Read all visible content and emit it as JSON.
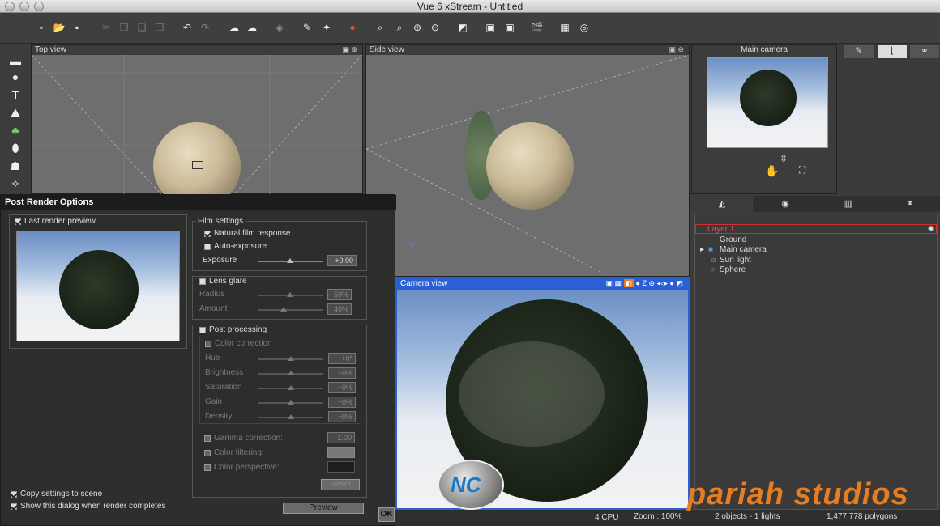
{
  "window": {
    "title": "Vue 6 xStream - Untitled"
  },
  "viewports": {
    "top": {
      "title": "Top view"
    },
    "side": {
      "title": "Side view",
      "axis_label": "Y"
    },
    "camera": {
      "title": "Camera view",
      "z_label": "Z"
    },
    "main_camera": {
      "title": "Main camera"
    }
  },
  "dialog": {
    "title": "Post Render Options",
    "last_render_preview": "Last render preview",
    "film_settings": {
      "title": "Film settings",
      "natural_film": "Natural film response",
      "auto_exposure": "Auto-exposure",
      "exposure_label": "Exposure",
      "exposure_value": "+0.00"
    },
    "lens_glare": {
      "title": "Lens glare",
      "radius_label": "Radius",
      "radius_value": "50%",
      "amount_label": "Amount",
      "amount_value": "40%"
    },
    "post_processing": {
      "title": "Post processing",
      "color_correction": "Color correction",
      "hue_label": "Hue",
      "hue_value": "+0°",
      "brightness_label": "Brightness",
      "brightness_value": "+0%",
      "saturation_label": "Saturation",
      "saturation_value": "+0%",
      "gain_label": "Gain",
      "gain_value": "+0%",
      "density_label": "Density",
      "density_value": "+0%",
      "gamma_label": "Gamma correction:",
      "gamma_value": "1.00",
      "color_filtering": "Color filtering:",
      "color_perspective": "Color perspective:",
      "reset": "Reset"
    },
    "copy_settings": "Copy settings to scene",
    "show_dialog": "Show this dialog when render completes",
    "preview": "Preview",
    "ok": "OK"
  },
  "world_browser": {
    "layer": "Layer 1",
    "items": [
      "Ground",
      "Main camera",
      "Sun light",
      "Sphere"
    ]
  },
  "status": {
    "cpu": "4 CPU",
    "zoom": "Zoom : 100%",
    "objects": "2 objects - 1 lights",
    "polygons": "1,477,778 polygons"
  },
  "watermark": "pariah studios",
  "colors": {
    "accent_blue": "#2a5fd6",
    "layer_red": "#d03030",
    "dialog_bg": "#2d2f2d"
  }
}
